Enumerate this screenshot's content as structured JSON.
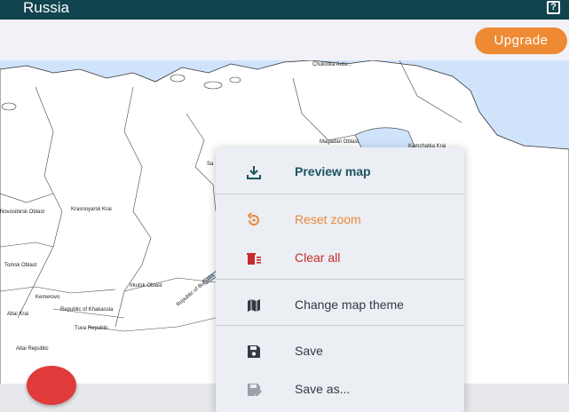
{
  "app": {
    "title": "Russia",
    "help_glyph": "?"
  },
  "toolbar": {
    "upgrade_label": "Upgrade"
  },
  "map": {
    "labels": [
      "Chukotka Auto...",
      "Magadan Oblast",
      "Krasnoyarsk Krai",
      "Tomsk Oblast",
      "Irkutsk Oblast",
      "Altai Krai",
      "Tuva Republic",
      "Altai Republic",
      "Republic of Buryatia",
      "Kemerovo",
      "Republic of Khakassia",
      "Novosibirsk Oblast",
      "Kamchatka Krai",
      "Sa"
    ]
  },
  "menu": {
    "items": [
      {
        "label": "Preview map",
        "color": "#1b5560",
        "icon": "download-icon"
      },
      {
        "label": "Reset zoom",
        "color": "#e8893a",
        "icon": "reset-zoom-icon"
      },
      {
        "label": "Clear all",
        "color": "#c62b2b",
        "icon": "clear-all-icon"
      },
      {
        "label": "Change map theme",
        "color": "#333a44",
        "icon": "map-theme-icon"
      },
      {
        "label": "Save",
        "color": "#333a44",
        "icon": "save-icon"
      },
      {
        "label": "Save as...",
        "color": "#333a44",
        "icon": "save-as-icon"
      }
    ]
  },
  "colors": {
    "topbar": "#12444f",
    "accent": "#ee8a33",
    "fab": "#e03a3a",
    "sea": "#cfe3fb"
  }
}
